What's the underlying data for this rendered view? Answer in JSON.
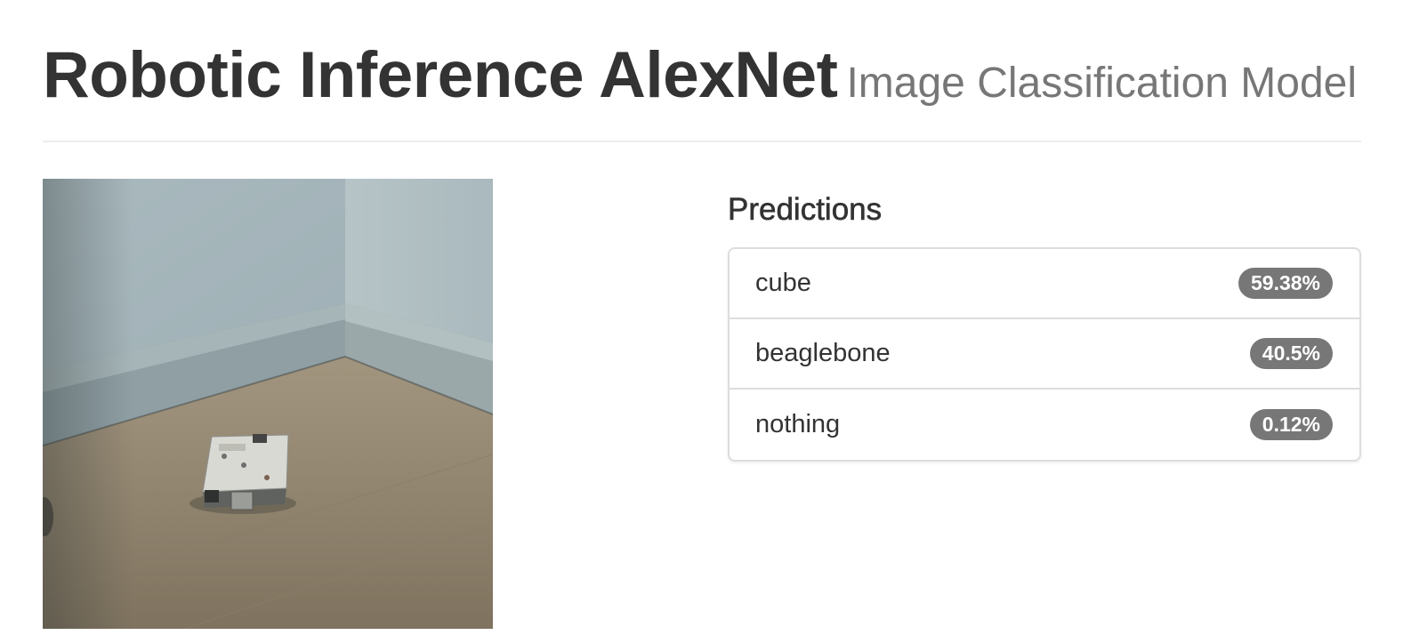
{
  "header": {
    "title": "Robotic Inference AlexNet",
    "subtitle": "Image Classification Model"
  },
  "predictions": {
    "heading": "Predictions",
    "items": [
      {
        "label": "cube",
        "value": "59.38%"
      },
      {
        "label": "beaglebone",
        "value": "40.5%"
      },
      {
        "label": "nothing",
        "value": "0.12%"
      }
    ]
  }
}
